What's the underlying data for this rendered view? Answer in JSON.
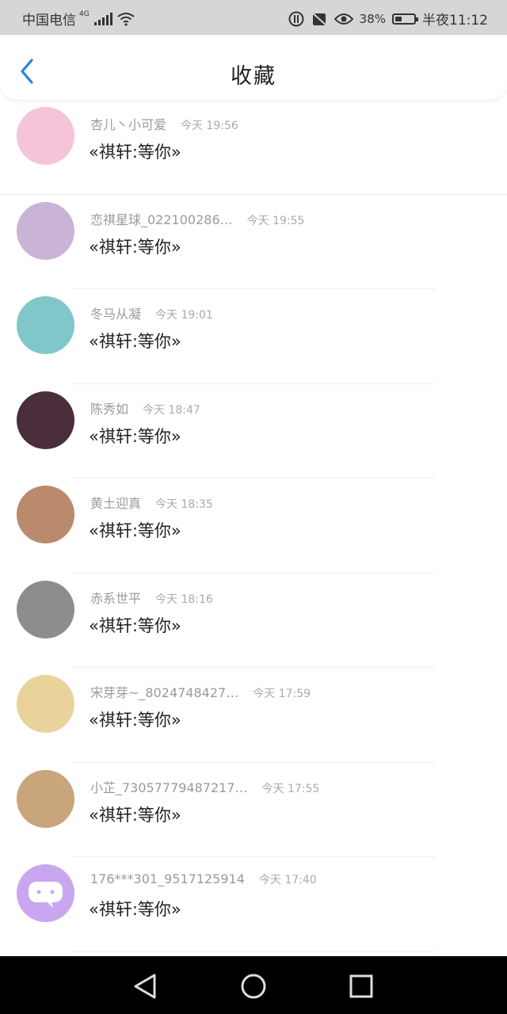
{
  "status_bar": {
    "carrier": "中国电信",
    "network": "4G",
    "battery": "38%",
    "battery_level": 0.38,
    "time": "半夜11:12"
  },
  "header": {
    "title": "收藏"
  },
  "items": [
    {
      "name": "杏儿丶小可爱",
      "time": "今天 19:56",
      "message": "«祺轩:等你»",
      "avatar_color": "#f5c4d8"
    },
    {
      "name": "恋祺星球_022100286…",
      "time": "今天 19:55",
      "message": "«祺轩:等你»",
      "avatar_color": "#c9b4d6"
    },
    {
      "name": "冬马从凝",
      "time": "今天 19:01",
      "message": "«祺轩:等你»",
      "avatar_color": "#7fc7c9"
    },
    {
      "name": "陈秀如",
      "time": "今天 18:47",
      "message": "«祺轩:等你»",
      "avatar_color": "#4a2e3c"
    },
    {
      "name": "黄土迎真",
      "time": "今天 18:35",
      "message": "«祺轩:等你»",
      "avatar_color": "#b98a6c"
    },
    {
      "name": "赤系世平",
      "time": "今天 18:16",
      "message": "«祺轩:等你»",
      "avatar_color": "#8d8d8d"
    },
    {
      "name": "宋芽芽~_8024748427…",
      "time": "今天 17:59",
      "message": "«祺轩:等你»",
      "avatar_color": "#e9d39a"
    },
    {
      "name": "小芷_730577794872­17…",
      "time": "今天 17:55",
      "message": "«祺轩:等你»",
      "avatar_color": "#c8a57a"
    },
    {
      "name": "176***301_9517125914",
      "time": "今天 17:40",
      "message": "«祺轩:等你»",
      "avatar_color": "#c8a7f0"
    }
  ]
}
